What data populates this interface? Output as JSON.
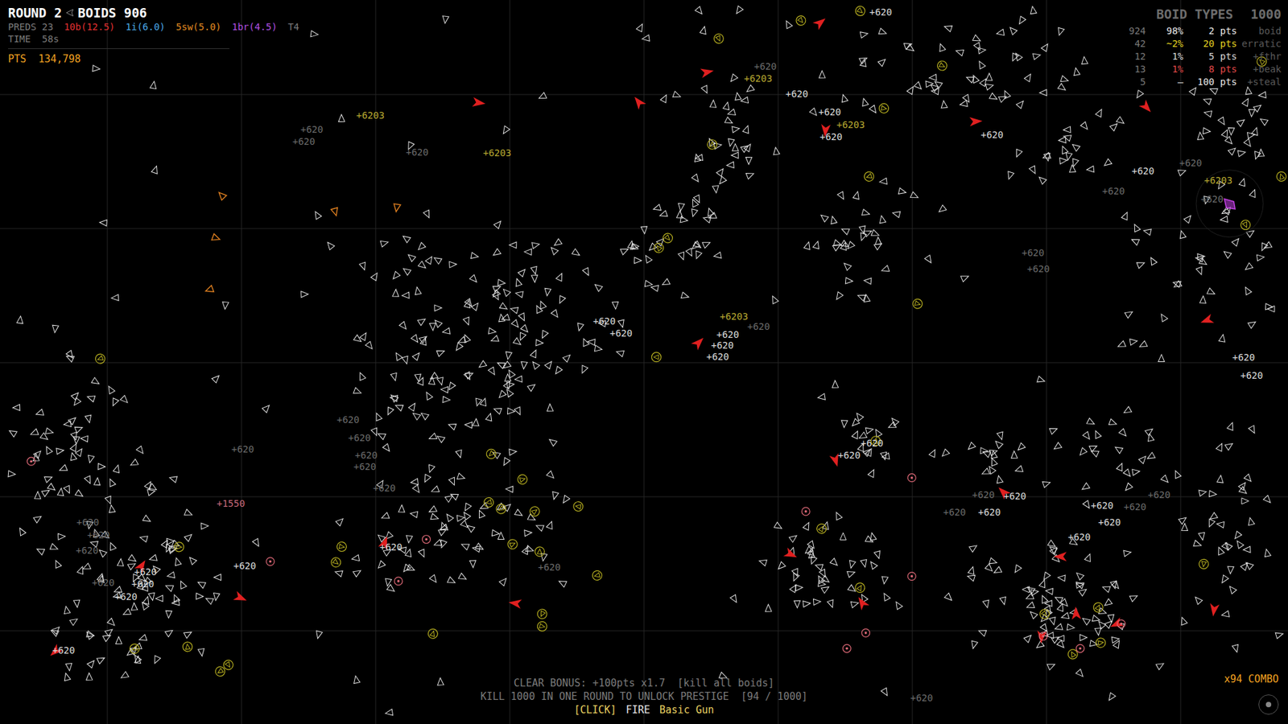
{
  "hud": {
    "round": "ROUND 2",
    "boids": "BOIDS 906",
    "preds": "PREDS 23",
    "pred_types": [
      {
        "text": "10b(12.5)",
        "color": "#e03030"
      },
      {
        "text": "1i(6.0)",
        "color": "#4aa8e8"
      },
      {
        "text": "5sw(5.0)",
        "color": "#e08a20"
      },
      {
        "text": "1br(4.5)",
        "color": "#b050e0"
      }
    ],
    "tier": "T4",
    "time": "TIME  58s",
    "pts": "PTS  134,798"
  },
  "boid_types": {
    "title": "BOID TYPES",
    "total": "1000",
    "rows": [
      {
        "count": "924",
        "share": "98%",
        "pts": "2 pts",
        "name": "boid",
        "color": "#e8e8e8"
      },
      {
        "count": "42",
        "share": "~2%",
        "pts": "20 pts",
        "name": "erratic",
        "color": "#e0d020"
      },
      {
        "count": "12",
        "share": "1%",
        "pts": "5 pts",
        "name": "+fthr",
        "color": "#d8d8d8"
      },
      {
        "count": "13",
        "share": "1%",
        "pts": "8 pts",
        "name": "+beak",
        "color": "#e04848"
      },
      {
        "count": "5",
        "share": "–",
        "pts": "100 pts",
        "name": "+steal",
        "color": "#e8e8e8"
      }
    ]
  },
  "footer": {
    "clear_bonus": "CLEAR BONUS: +100pts x1.7  [kill all boids]",
    "prestige": "KILL 1000 IN ONE ROUND TO UNLOCK PRESTIGE  [94 / 1000]",
    "fire_key": "[CLICK]",
    "fire_action": "FIRE",
    "weapon": "Basic Gun",
    "combo": "x94 COMBO"
  },
  "sprites": [
    {
      "kind": "boid",
      "count": 840,
      "color": "#e6e6e6"
    },
    {
      "kind": "erratic",
      "count": 42,
      "color": "#b8b020"
    },
    {
      "kind": "predator",
      "count": 23,
      "color": "#e02020"
    },
    {
      "kind": "swarmer",
      "count": 5,
      "color": "#e08020"
    },
    {
      "kind": "target",
      "count": 12,
      "color": "#e06a78"
    },
    {
      "kind": "brute",
      "count": 1,
      "color": "#c040e0"
    }
  ],
  "popups": [
    {
      "text": "+620",
      "color": "#dcdcdc"
    },
    {
      "text": "+620",
      "color": "#6a6a6a"
    },
    {
      "text": "+6203",
      "color": "#b8a830"
    },
    {
      "text": "+620",
      "color": "#dcdcdc"
    },
    {
      "text": "+620",
      "color": "#dcdcdc"
    },
    {
      "text": "+6203",
      "color": "#b8a830"
    },
    {
      "text": "+620",
      "color": "#dcdcdc"
    },
    {
      "text": "+620",
      "color": "#dcdcdc"
    },
    {
      "text": "+6203",
      "color": "#b8a830"
    },
    {
      "text": "+620",
      "color": "#6a6a6a"
    },
    {
      "text": "+620",
      "color": "#6a6a6a"
    },
    {
      "text": "+620",
      "color": "#6a6a6a"
    },
    {
      "text": "+6203",
      "color": "#b8a830"
    },
    {
      "text": "+620",
      "color": "#dcdcdc"
    },
    {
      "text": "+620",
      "color": "#6a6a6a"
    },
    {
      "text": "+620",
      "color": "#6a6a6a"
    },
    {
      "text": "+6203",
      "color": "#b8a830"
    },
    {
      "text": "+620",
      "color": "#6a6a6a"
    },
    {
      "text": "+620",
      "color": "#6a6a6a"
    },
    {
      "text": "+620",
      "color": "#6a6a6a"
    },
    {
      "text": "+620",
      "color": "#dcdcdc"
    },
    {
      "text": "+620",
      "color": "#dcdcdc"
    },
    {
      "text": "+6203",
      "color": "#b8a830"
    },
    {
      "text": "+620",
      "color": "#6a6a6a"
    },
    {
      "text": "+620",
      "color": "#dcdcdc"
    },
    {
      "text": "+620",
      "color": "#dcdcdc"
    },
    {
      "text": "+620",
      "color": "#dcdcdc"
    },
    {
      "text": "+620",
      "color": "#dcdcdc"
    },
    {
      "text": "+620",
      "color": "#dcdcdc"
    },
    {
      "text": "+620",
      "color": "#6a6a6a"
    },
    {
      "text": "+620",
      "color": "#6a6a6a"
    },
    {
      "text": "+620",
      "color": "#6a6a6a"
    },
    {
      "text": "+620",
      "color": "#6a6a6a"
    },
    {
      "text": "+620",
      "color": "#6a6a6a"
    },
    {
      "text": "+620",
      "color": "#6a6a6a"
    },
    {
      "text": "+1550",
      "color": "#c86a7a"
    },
    {
      "text": "+620",
      "color": "#6a6a6a"
    },
    {
      "text": "+620",
      "color": "#6a6a6a"
    },
    {
      "text": "+620",
      "color": "#6a6a6a"
    },
    {
      "text": "+620",
      "color": "#dcdcdc"
    },
    {
      "text": "+620",
      "color": "#dcdcdc"
    },
    {
      "text": "+620",
      "color": "#dcdcdc"
    },
    {
      "text": "+620",
      "color": "#6a6a6a"
    },
    {
      "text": "+620",
      "color": "#dcdcdc"
    },
    {
      "text": "+620",
      "color": "#dcdcdc"
    },
    {
      "text": "+620",
      "color": "#dcdcdc"
    },
    {
      "text": "+620",
      "color": "#6a6a6a"
    },
    {
      "text": "+620",
      "color": "#dcdcdc"
    },
    {
      "text": "+620",
      "color": "#dcdcdc"
    },
    {
      "text": "+620",
      "color": "#dcdcdc"
    },
    {
      "text": "+620",
      "color": "#6a6a6a"
    },
    {
      "text": "+620",
      "color": "#dcdcdc"
    },
    {
      "text": "+620",
      "color": "#6a6a6a"
    },
    {
      "text": "+620",
      "color": "#dcdcdc"
    },
    {
      "text": "+620",
      "color": "#dcdcdc"
    },
    {
      "text": "+620",
      "color": "#6a6a6a"
    },
    {
      "text": "+620",
      "color": "#dcdcdc"
    },
    {
      "text": "+620",
      "color": "#6a6a6a"
    },
    {
      "text": "+620",
      "color": "#6a6a6a"
    }
  ]
}
